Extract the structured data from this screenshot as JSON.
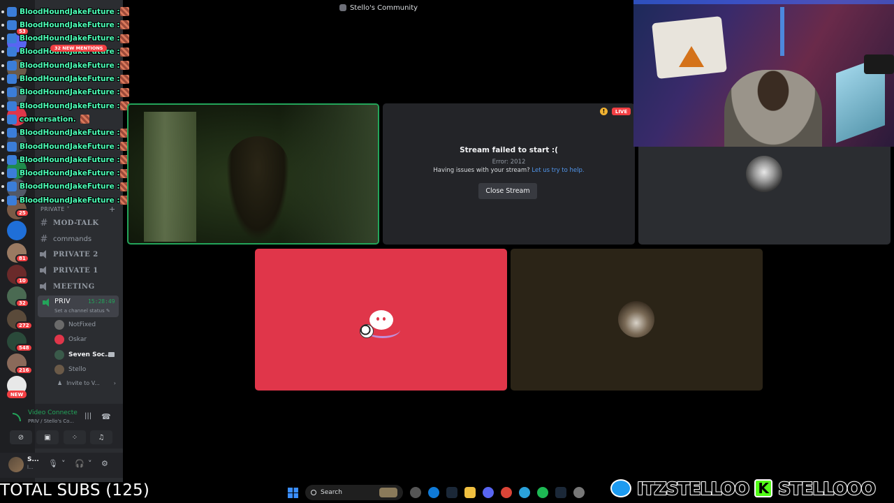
{
  "window": {
    "title": "Stello's Community"
  },
  "chat": {
    "username": "BloodHoundJakeFuture :",
    "message_fragment": "conversation.",
    "mentions": "32 NEW MENTIONS",
    "lines": 15
  },
  "server_badges": [
    "53",
    "25",
    "81",
    "10",
    "32",
    "272",
    "548",
    "216"
  ],
  "server_new": "NEW",
  "sidebar": {
    "category": "PRIVATE",
    "channels": [
      {
        "kind": "text",
        "label": "MOD-TALK",
        "style": "bold"
      },
      {
        "kind": "text",
        "label": "commands",
        "style": "normal"
      },
      {
        "kind": "voice",
        "label": "PRIVATE 2",
        "style": "bold"
      },
      {
        "kind": "voice",
        "label": "PRIVATE 1",
        "style": "bold"
      },
      {
        "kind": "voice",
        "label": "MEETING",
        "style": "bold"
      }
    ],
    "active_channel": {
      "label": "PRIV",
      "timer": "15:28:49",
      "status_prompt": "Set a channel status"
    },
    "voice_users": [
      {
        "name": "NotFixed",
        "bold": false
      },
      {
        "name": "Oskar",
        "bold": false
      },
      {
        "name": "Seven Soc...",
        "bold": true
      },
      {
        "name": "Stello",
        "bold": false
      }
    ],
    "invite": "Invite to V..."
  },
  "voice_panel": {
    "title": "Video Connecte",
    "subtitle": "PRIV / Stello's Co..."
  },
  "user_panel": {
    "name": "S...",
    "status": "l..."
  },
  "stream_tile": {
    "title": "Stream failed to start :(",
    "error": "Error: 2012",
    "help_text": "Having issues with your stream?",
    "help_link": "Let us try to help.",
    "close_label": "Close Stream",
    "live_label": "LIVE",
    "warn_glyph": "!"
  },
  "overlay": {
    "total_subs": "TOTAL SUBS (125)",
    "twitter_handle": "ITZSTELLOO",
    "kick_letter": "K",
    "kick_handle": "STELLOOO"
  },
  "taskbar": {
    "search_placeholder": "Search"
  },
  "colors": {
    "accent_green": "#23a55a",
    "chat_name": "#4dffb8",
    "discord_red": "#e0364a",
    "danger": "#f23f43",
    "link": "#5197ed"
  }
}
